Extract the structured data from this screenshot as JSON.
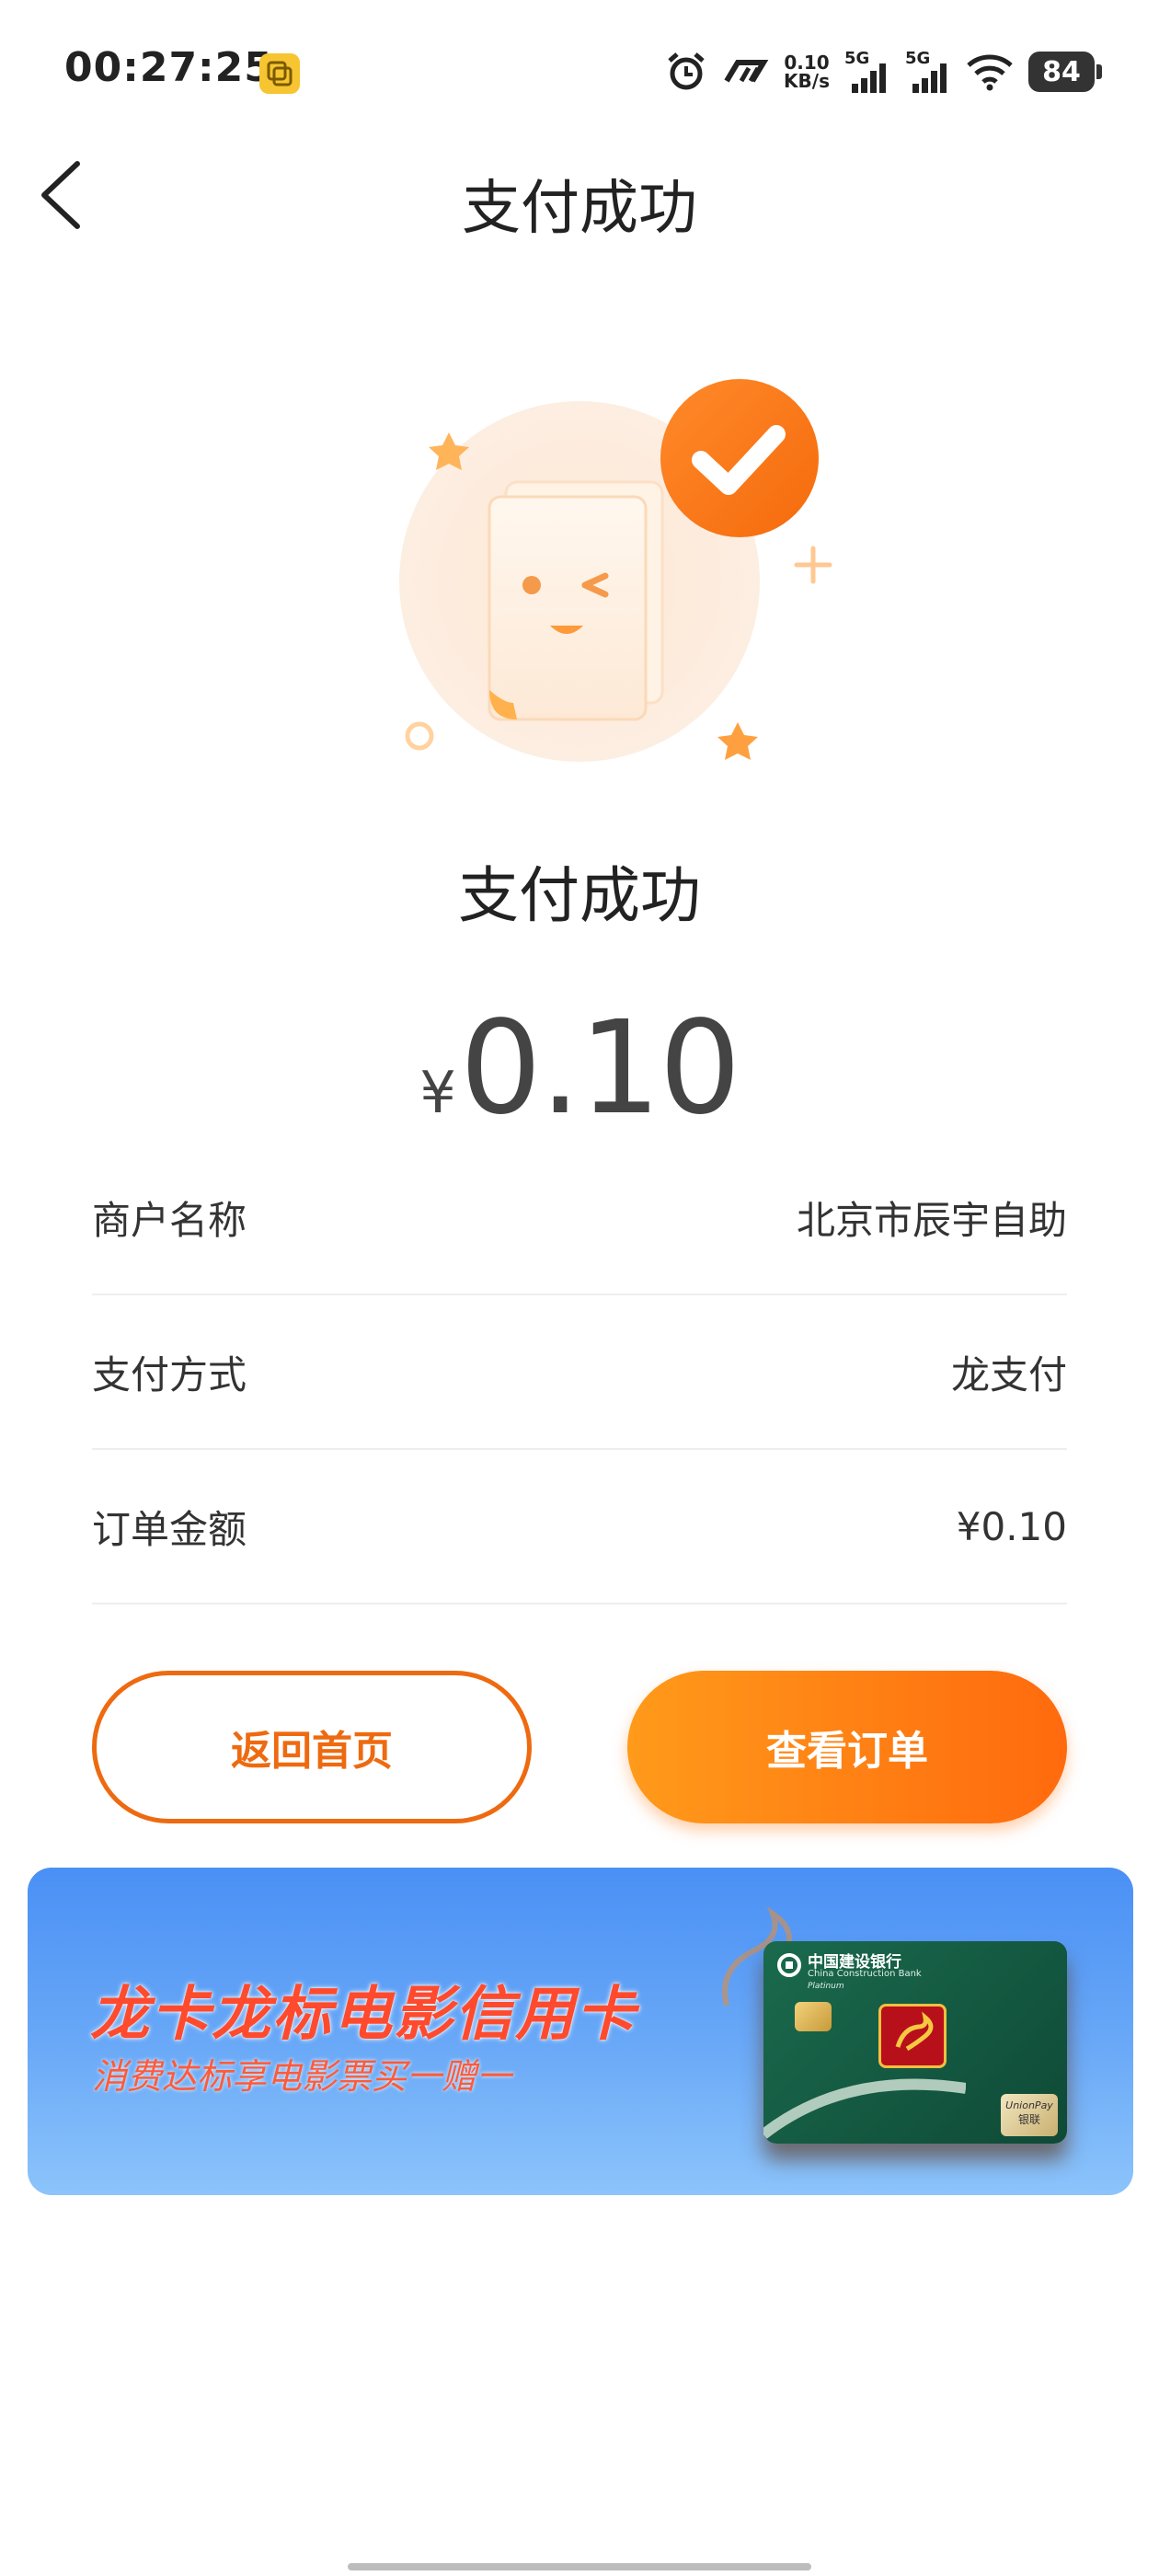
{
  "status_bar": {
    "time": "00:27:25",
    "net_speed_value": "0.10",
    "net_speed_unit": "KB/s",
    "sim1_label": "5G",
    "sim2_label": "5G",
    "battery": "84"
  },
  "header": {
    "title": "支付成功"
  },
  "result": {
    "status_text": "支付成功",
    "currency": "¥",
    "amount": "0.10"
  },
  "details": [
    {
      "label": "商户名称",
      "value": "北京市辰宇自助"
    },
    {
      "label": "支付方式",
      "value": "龙支付"
    },
    {
      "label": "订单金额",
      "value": "¥0.10"
    }
  ],
  "buttons": {
    "home_label": "返回首页",
    "order_label": "查看订单"
  },
  "banner": {
    "title": "龙卡龙标电影信用卡",
    "subtitle": "消费达标享电影票买一赠一",
    "card_bank_cn": "中国建设银行",
    "card_bank_en": "China Construction Bank",
    "card_tier": "Platinum",
    "card_network_en": "UnionPay",
    "card_network_cn": "银联"
  },
  "colors": {
    "accent": "#ff7a14",
    "accent_dark": "#ee6a10",
    "banner_blue": "#4a90f5"
  }
}
